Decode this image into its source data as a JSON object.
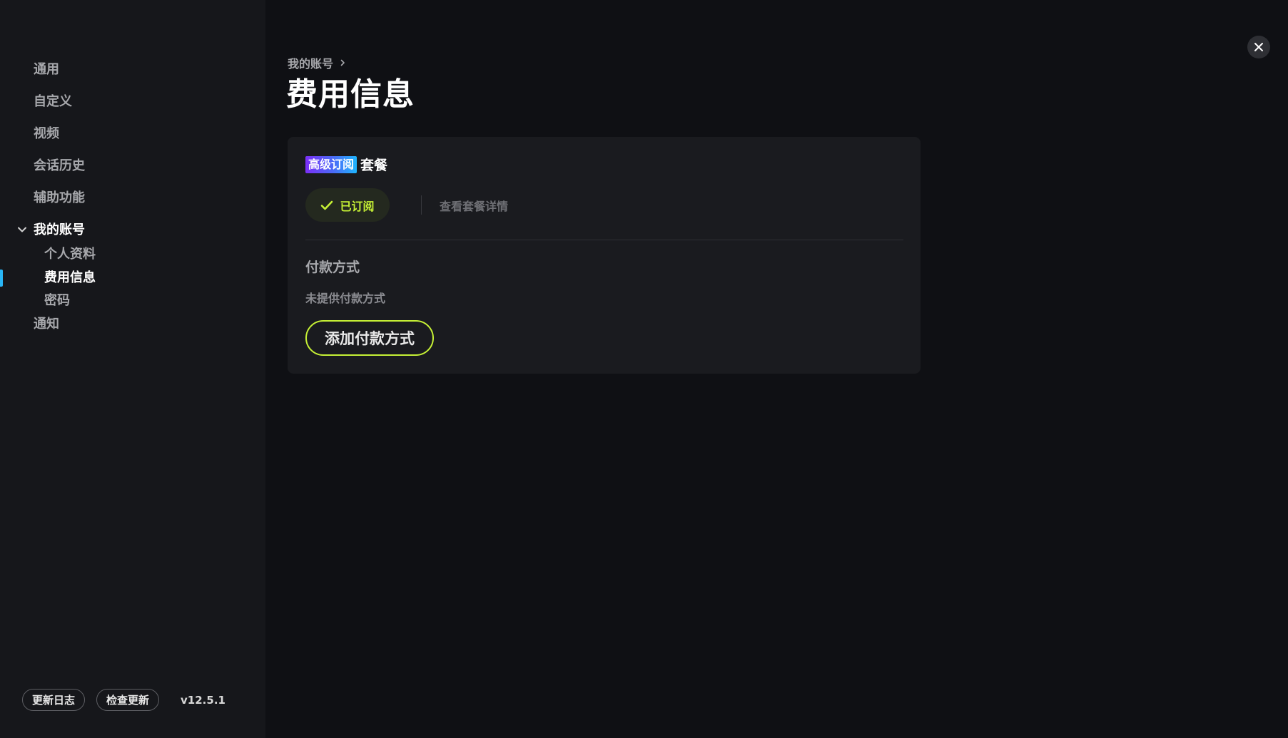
{
  "sidebar": {
    "items": [
      {
        "label": "通用"
      },
      {
        "label": "自定义"
      },
      {
        "label": "视频"
      },
      {
        "label": "会话历史"
      },
      {
        "label": "辅助功能"
      },
      {
        "label": "我的账号",
        "expanded": true,
        "children": [
          {
            "label": "个人资料"
          },
          {
            "label": "费用信息",
            "active": true
          },
          {
            "label": "密码"
          }
        ]
      },
      {
        "label": "通知"
      }
    ],
    "footer": {
      "changelog_label": "更新日志",
      "check_update_label": "检查更新",
      "version": "v12.5.1"
    }
  },
  "header": {
    "breadcrumb": "我的账号",
    "title": "费用信息"
  },
  "plan": {
    "badge": "高级订阅",
    "suffix": "套餐",
    "status": "已订阅",
    "details_link": "查看套餐详情"
  },
  "payment": {
    "title": "付款方式",
    "empty_text": "未提供付款方式",
    "add_button": "添加付款方式"
  },
  "colors": {
    "accent_lime": "#c6f135",
    "active_indicator": "#29b6f6",
    "badge_gradient_start": "#7b2ff7",
    "badge_gradient_end": "#1fb6ff"
  },
  "icons": {
    "close": "close-icon",
    "check": "check-icon",
    "chevron_down": "chevron-down-icon",
    "chevron_right": "chevron-right-icon"
  }
}
